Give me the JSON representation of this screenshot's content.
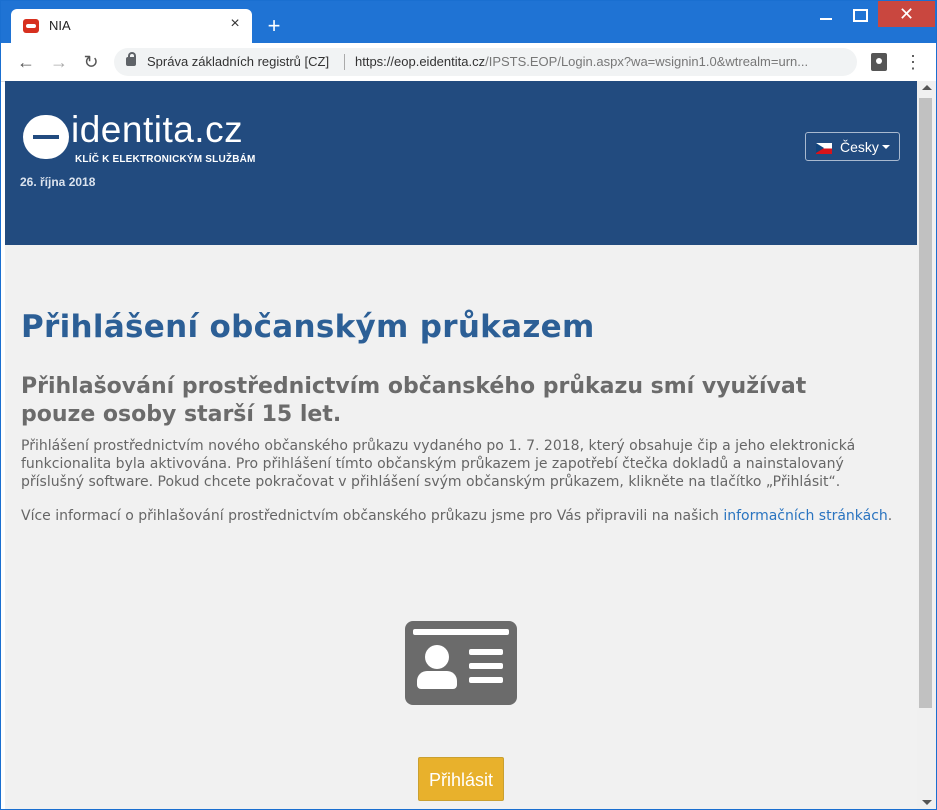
{
  "browser": {
    "tab_title": "NIA",
    "tab_close": "×",
    "new_tab": "+",
    "site_identity": "Správa základních registrů [CZ]",
    "url_host": "https://eop.eidentita.cz",
    "url_rest": "/IPSTS.EOP/Login.aspx?wa=wsignin1.0&wtrealm=urn...",
    "close_glyph": "✕",
    "back": "←",
    "forward": "→",
    "reload": "↻",
    "menu": "⋮"
  },
  "header": {
    "logo_text": "identita.cz",
    "logo_tagline": "KLÍČ K ELEKTRONICKÝM SLUŽBÁM",
    "date": "26. října 2018",
    "language": "Česky"
  },
  "main": {
    "title": "Přihlášení občanským průkazem",
    "subtitle": "Přihlašování prostřednictvím občanského průkazu smí využívat pouze osoby starší 15 let.",
    "paragraph1": "Přihlášení prostřednictvím nového občanského průkazu vydaného po 1. 7. 2018, který obsahuje čip a jeho elektronická funkcionalita byla aktivována. Pro přihlášení tímto občanským průkazem je zapotřebí čtečka dokladů a nainstalovaný příslušný software. Pokud chcete pokračovat v přihlášení svým občanským průkazem, klikněte na tlačítko „Přihlásit“.",
    "paragraph2_prefix": "Více informací o přihlašování prostřednictvím občanského průkazu jsme pro Vás připravili na našich ",
    "paragraph2_link": "informačních stránkách",
    "paragraph2_suffix": ".",
    "login_button": "Přihlásit"
  },
  "colors": {
    "header_bg": "#224b7f",
    "title": "#2c5f96",
    "button": "#e8b12c",
    "link": "#2a74c0"
  }
}
